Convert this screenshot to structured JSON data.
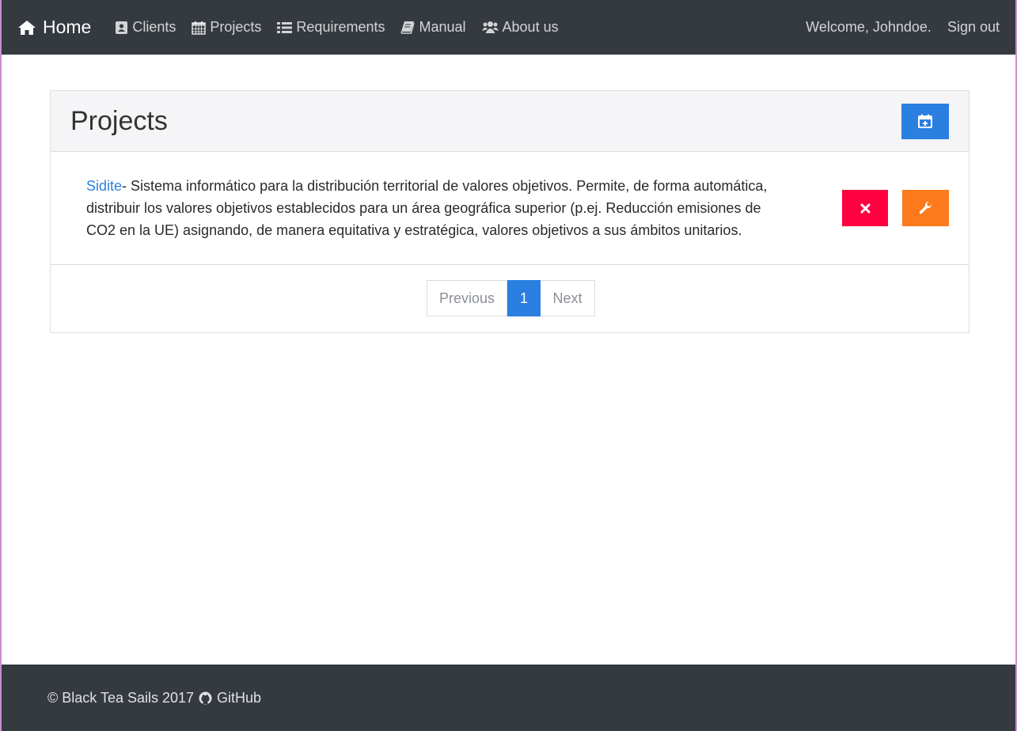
{
  "navbar": {
    "brand": {
      "label": "Home",
      "icon": "home-icon"
    },
    "items": [
      {
        "label": "Clients",
        "icon": "address-card-icon"
      },
      {
        "label": "Projects",
        "icon": "calendar-icon"
      },
      {
        "label": "Requirements",
        "icon": "list-icon"
      },
      {
        "label": "Manual",
        "icon": "book-icon"
      },
      {
        "label": "About us",
        "icon": "users-icon"
      }
    ],
    "welcome": "Welcome, Johndoe.",
    "sign_out": "Sign out"
  },
  "card": {
    "title": "Projects",
    "add_button_icon": "calendar-plus-icon",
    "projects": [
      {
        "name": "Sidite",
        "description": "- Sistema informático para la distribución territorial de valores objetivos. Permite, de forma automática, distribuir los valores objetivos establecidos para un área geográfica superior (p.ej. Reducción emisiones de CO2 en la UE) asignando, de manera equitativa y estratégica, valores objetivos a sus ámbitos unitarios.",
        "delete_icon": "close-icon",
        "edit_icon": "wrench-icon"
      }
    ],
    "pagination": {
      "previous": "Previous",
      "current": "1",
      "next": "Next"
    }
  },
  "footer": {
    "copyright": "© Black Tea Sails 2017",
    "github": "GitHub",
    "github_icon": "github-icon"
  },
  "colors": {
    "navbar_bg": "#343a40",
    "primary": "#2a7fe0",
    "danger": "#ff0040",
    "warning": "#fd7a1c"
  }
}
